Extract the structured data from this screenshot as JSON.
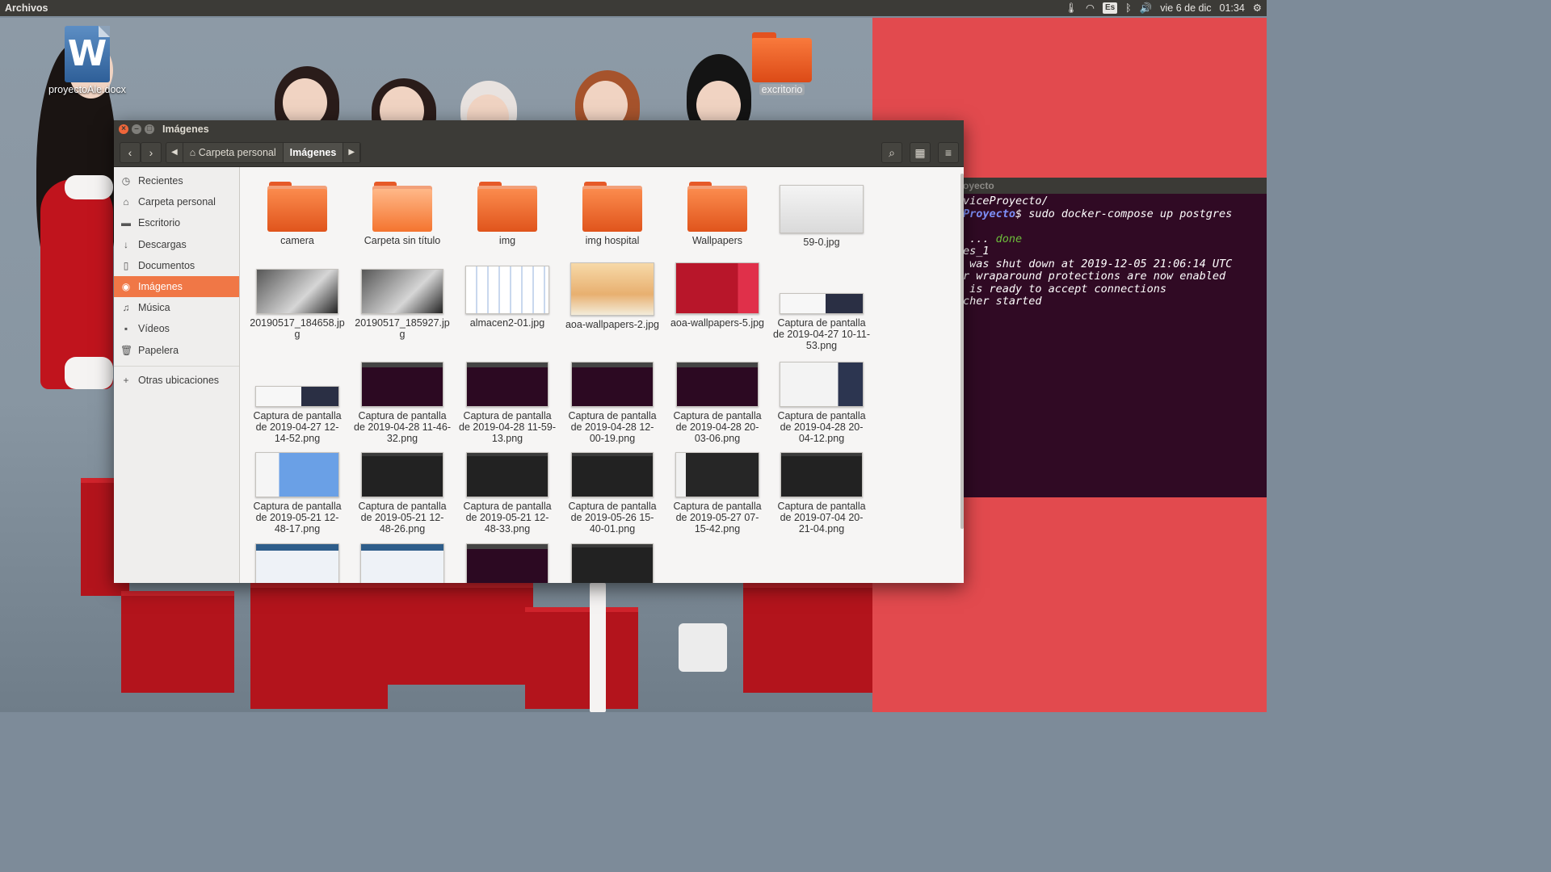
{
  "top_panel": {
    "app_name": "Archivos",
    "keyboard_layout": "Es",
    "date": "vie 6 de dic",
    "time": "01:34"
  },
  "desktop": {
    "icons": [
      {
        "label": "proyectoAle.docx",
        "type": "word-document-icon"
      },
      {
        "label": "excritorio",
        "type": "folder-icon"
      }
    ]
  },
  "terminal": {
    "title": "oyecto",
    "lines": [
      {
        "segments": [
          {
            "text": "viceProyecto/",
            "style": "plain"
          }
        ]
      },
      {
        "segments": [
          {
            "text": "Proyecto",
            "style": "blue"
          },
          {
            "text": "$ sudo docker-compose up postgres",
            "style": "plain"
          }
        ]
      },
      {
        "segments": [
          {
            "text": "",
            "style": "plain"
          }
        ]
      },
      {
        "segments": [
          {
            "text": " ... ",
            "style": "plain"
          },
          {
            "text": "done",
            "style": "green"
          }
        ]
      },
      {
        "segments": [
          {
            "text": "es_1",
            "style": "plain"
          }
        ]
      },
      {
        "segments": [
          {
            "text": " was shut down at 2019-12-05 21:06:14 UTC",
            "style": "plain"
          }
        ]
      },
      {
        "segments": [
          {
            "text": "r wraparound protections are now enabled",
            "style": "plain"
          }
        ]
      },
      {
        "segments": [
          {
            "text": " is ready to accept connections",
            "style": "plain"
          }
        ]
      },
      {
        "segments": [
          {
            "text": "cher started",
            "style": "plain"
          }
        ]
      }
    ]
  },
  "window": {
    "title": "Imágenes",
    "breadcrumbs": [
      "Carpeta personal",
      "Imágenes"
    ],
    "sidebar": [
      {
        "label": "Recientes",
        "icon": "clock-icon",
        "glyph": "◷"
      },
      {
        "label": "Carpeta personal",
        "icon": "home-icon",
        "glyph": "⌂"
      },
      {
        "label": "Escritorio",
        "icon": "desktop-icon",
        "glyph": "▬"
      },
      {
        "label": "Descargas",
        "icon": "download-icon",
        "glyph": "↓"
      },
      {
        "label": "Documentos",
        "icon": "document-icon",
        "glyph": "▯"
      },
      {
        "label": "Imágenes",
        "icon": "camera-icon",
        "glyph": "◉",
        "active": true
      },
      {
        "label": "Música",
        "icon": "music-icon",
        "glyph": "♫"
      },
      {
        "label": "Vídeos",
        "icon": "video-icon",
        "glyph": "▪"
      },
      {
        "label": "Papelera",
        "icon": "trash-icon",
        "glyph": "🗑"
      }
    ],
    "other_locations": {
      "label": "Otras ubicaciones",
      "icon": "plus-icon",
      "glyph": "+"
    },
    "files": [
      {
        "name": "camera",
        "kind": "folder"
      },
      {
        "name": "Carpeta sin título",
        "kind": "folder-light"
      },
      {
        "name": "img",
        "kind": "folder"
      },
      {
        "name": "img hospital",
        "kind": "folder"
      },
      {
        "name": "Wallpapers",
        "kind": "folder"
      },
      {
        "name": "59-0.jpg",
        "kind": "image",
        "preview": "document-scan"
      },
      {
        "name": "20190517_184658.jpg",
        "kind": "image",
        "preview": "photo-dark"
      },
      {
        "name": "20190517_185927.jpg",
        "kind": "image",
        "preview": "photo-dark"
      },
      {
        "name": "almacen2-01.jpg",
        "kind": "image",
        "preview": "diagram"
      },
      {
        "name": "aoa-wallpapers-2.jpg",
        "kind": "image",
        "preview": "group-photo-light"
      },
      {
        "name": "aoa-wallpapers-5.jpg",
        "kind": "image",
        "preview": "group-photo-red"
      },
      {
        "name": "Captura de pantalla de 2019-04-27 10-11-53.png",
        "kind": "image",
        "preview": "wide-screenshot"
      },
      {
        "name": "Captura de pantalla de 2019-04-27 12-14-52.png",
        "kind": "image",
        "preview": "wide-screenshot"
      },
      {
        "name": "Captura de pantalla de 2019-04-28 11-46-32.png",
        "kind": "image",
        "preview": "terminal"
      },
      {
        "name": "Captura de pantalla de 2019-04-28 11-59-13.png",
        "kind": "image",
        "preview": "terminal"
      },
      {
        "name": "Captura de pantalla de 2019-04-28 12-00-19.png",
        "kind": "image",
        "preview": "terminal"
      },
      {
        "name": "Captura de pantalla de 2019-04-28 20-03-06.png",
        "kind": "image",
        "preview": "terminal"
      },
      {
        "name": "Captura de pantalla de 2019-04-28 20-04-12.png",
        "kind": "image",
        "preview": "browser"
      },
      {
        "name": "Captura de pantalla de 2019-05-21 12-48-17.png",
        "kind": "image",
        "preview": "blue-page"
      },
      {
        "name": "Captura de pantalla de 2019-05-21 12-48-26.png",
        "kind": "image",
        "preview": "code"
      },
      {
        "name": "Captura de pantalla de 2019-05-21 12-48-33.png",
        "kind": "image",
        "preview": "code"
      },
      {
        "name": "Captura de pantalla de 2019-05-26 15-40-01.png",
        "kind": "image",
        "preview": "code"
      },
      {
        "name": "Captura de pantalla de 2019-05-27 07-15-42.png",
        "kind": "image",
        "preview": "code-light"
      },
      {
        "name": "Captura de pantalla de 2019-07-04 20-21-04.png",
        "kind": "image",
        "preview": "code"
      },
      {
        "name": "",
        "kind": "image",
        "preview": "web-page"
      },
      {
        "name": "",
        "kind": "image",
        "preview": "web-page"
      },
      {
        "name": "",
        "kind": "image",
        "preview": "terminal"
      },
      {
        "name": "",
        "kind": "image",
        "preview": "code"
      }
    ]
  },
  "colors": {
    "panel": "#3c3b37",
    "accent": "#f07746",
    "terminal_bg": "#300a24",
    "folder_orange": "#e0541c"
  }
}
